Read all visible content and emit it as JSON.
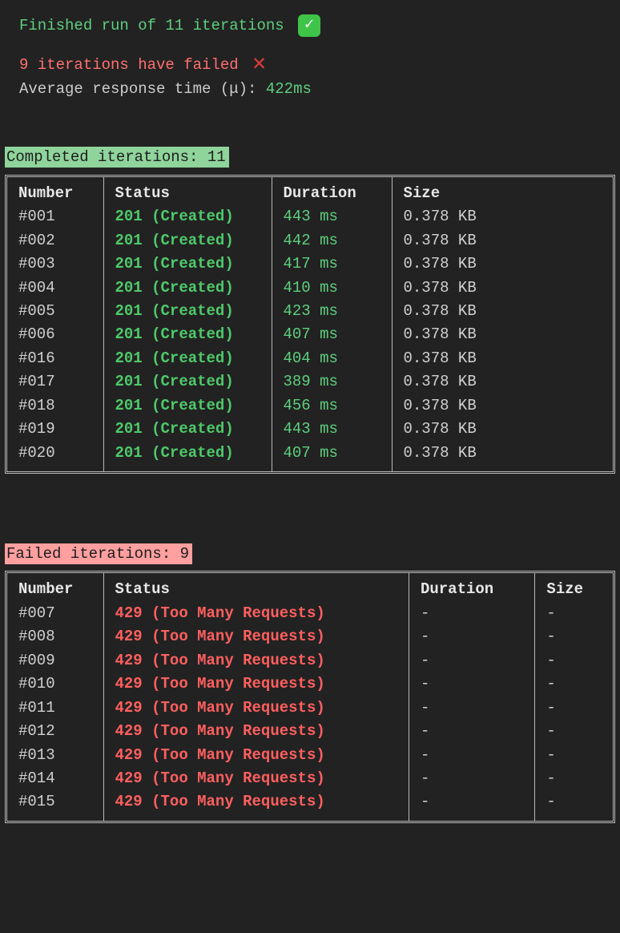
{
  "summary": {
    "finished": "Finished run of 11 iterations",
    "failed": "9 iterations have failed",
    "avg_label": "Average response time (μ): ",
    "avg_value": "422ms"
  },
  "completed": {
    "heading": "Completed iterations: 11",
    "headers": {
      "number": "Number",
      "status": "Status",
      "duration": "Duration",
      "size": "Size"
    },
    "rows": [
      {
        "number": "#001",
        "status": "201 (Created)",
        "duration": "443 ms",
        "size": "0.378 KB"
      },
      {
        "number": "#002",
        "status": "201 (Created)",
        "duration": "442 ms",
        "size": "0.378 KB"
      },
      {
        "number": "#003",
        "status": "201 (Created)",
        "duration": "417 ms",
        "size": "0.378 KB"
      },
      {
        "number": "#004",
        "status": "201 (Created)",
        "duration": "410 ms",
        "size": "0.378 KB"
      },
      {
        "number": "#005",
        "status": "201 (Created)",
        "duration": "423 ms",
        "size": "0.378 KB"
      },
      {
        "number": "#006",
        "status": "201 (Created)",
        "duration": "407 ms",
        "size": "0.378 KB"
      },
      {
        "number": "#016",
        "status": "201 (Created)",
        "duration": "404 ms",
        "size": "0.378 KB"
      },
      {
        "number": "#017",
        "status": "201 (Created)",
        "duration": "389 ms",
        "size": "0.378 KB"
      },
      {
        "number": "#018",
        "status": "201 (Created)",
        "duration": "456 ms",
        "size": "0.378 KB"
      },
      {
        "number": "#019",
        "status": "201 (Created)",
        "duration": "443 ms",
        "size": "0.378 KB"
      },
      {
        "number": "#020",
        "status": "201 (Created)",
        "duration": "407 ms",
        "size": "0.378 KB"
      }
    ]
  },
  "failed": {
    "heading": "Failed iterations: 9",
    "headers": {
      "number": "Number",
      "status": "Status",
      "duration": "Duration",
      "size": "Size"
    },
    "rows": [
      {
        "number": "#007",
        "status": "429 (Too Many Requests)",
        "duration": "-",
        "size": "-"
      },
      {
        "number": "#008",
        "status": "429 (Too Many Requests)",
        "duration": "-",
        "size": "-"
      },
      {
        "number": "#009",
        "status": "429 (Too Many Requests)",
        "duration": "-",
        "size": "-"
      },
      {
        "number": "#010",
        "status": "429 (Too Many Requests)",
        "duration": "-",
        "size": "-"
      },
      {
        "number": "#011",
        "status": "429 (Too Many Requests)",
        "duration": "-",
        "size": "-"
      },
      {
        "number": "#012",
        "status": "429 (Too Many Requests)",
        "duration": "-",
        "size": "-"
      },
      {
        "number": "#013",
        "status": "429 (Too Many Requests)",
        "duration": "-",
        "size": "-"
      },
      {
        "number": "#014",
        "status": "429 (Too Many Requests)",
        "duration": "-",
        "size": "-"
      },
      {
        "number": "#015",
        "status": "429 (Too Many Requests)",
        "duration": "-",
        "size": "-"
      }
    ]
  }
}
